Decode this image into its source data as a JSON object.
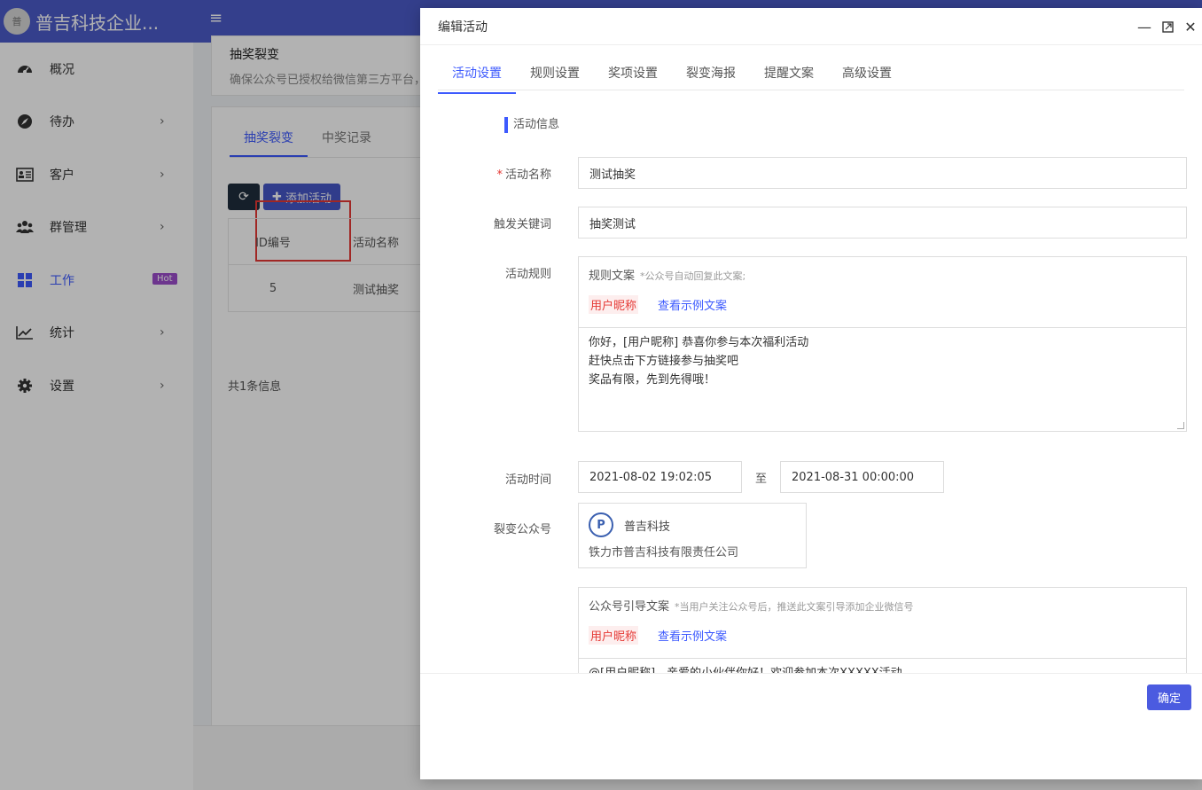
{
  "app": {
    "brand_name": "普吉科技企业...",
    "logo_text": "普",
    "menu_icon": "hamburger-icon"
  },
  "sidebar": {
    "items": [
      {
        "label": "概况",
        "icon": "dashboard-icon",
        "has_arrow": false
      },
      {
        "label": "待办",
        "icon": "compass-icon",
        "has_arrow": true
      },
      {
        "label": "客户",
        "icon": "contact-card-icon",
        "has_arrow": true
      },
      {
        "label": "群管理",
        "icon": "group-icon",
        "has_arrow": true
      },
      {
        "label": "工作",
        "icon": "grid-icon",
        "badge": "Hot",
        "active": true
      },
      {
        "label": "统计",
        "icon": "line-chart-icon",
        "has_arrow": true
      },
      {
        "label": "设置",
        "icon": "gear-icon",
        "has_arrow": true
      }
    ]
  },
  "page": {
    "notice_title": "抽奖裂变",
    "notice_text": "确保公众号已授权给微信第三方平台，",
    "tabs": [
      "抽奖裂变",
      "中奖记录"
    ],
    "add_button": "添加活动",
    "table_headers": [
      "ID编号",
      "活动名称"
    ],
    "table_rows": [
      [
        "5",
        "测试抽奖"
      ]
    ],
    "footer_text": "共1条信息"
  },
  "modal": {
    "title": "编辑活动",
    "tabs": [
      "活动设置",
      "规则设置",
      "奖项设置",
      "裂变海报",
      "提醒文案",
      "高级设置"
    ],
    "section_title": "活动信息",
    "fields": {
      "name_label": "活动名称",
      "name_value": "测试抽奖",
      "keyword_label": "触发关键词",
      "keyword_value": "抽奖测试",
      "rule_label": "活动规则",
      "rule_title": "规则文案",
      "rule_hint": "*公众号自动回复此文案;",
      "nick_tag": "用户昵称",
      "example_link": "查看示例文案",
      "rule_lines": [
        "你好，[用户昵称] 恭喜你参与本次福利活动",
        "赶快点击下方链接参与抽奖吧",
        "奖品有限，先到先得哦！"
      ],
      "time_label": "活动时间",
      "time_start": "2021-08-02 19:02:05",
      "time_sep": "至",
      "time_end": "2021-08-31 00:00:00",
      "oa_label": "裂变公众号",
      "oa_name": "普吉科技",
      "oa_company": "铁力市普吉科技有限责任公司",
      "guide_title": "公众号引导文案",
      "guide_hint": "*当用户关注公众号后，推送此文案引导添加企业微信号",
      "guide_line": "@[用户昵称]，亲爱的小伙伴你好！欢迎参加本次XXXXX活动"
    },
    "ok_button": "确定"
  },
  "colors": {
    "header": "#4b5bc9",
    "accent": "#3d5afe",
    "danger": "#e53935",
    "badge": "#9c4ccc"
  }
}
